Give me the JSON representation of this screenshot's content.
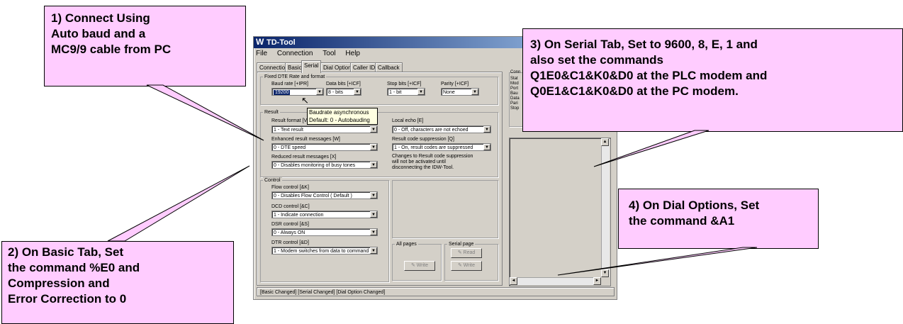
{
  "window": {
    "title": "TD-Tool",
    "menu": [
      "File",
      "Connection",
      "Tool",
      "Help"
    ],
    "tabs": [
      "Connection",
      "Basic",
      "Serial",
      "Dial Options",
      "Caller ID",
      "Callback"
    ],
    "active_tab": "Serial"
  },
  "fixed_dte": {
    "group_title": "Fixed DTE Rate and format",
    "baud_label": "Baud rate [+IPR]",
    "baud_value": "19200",
    "databits_label": "Data bits [+ICF]",
    "databits_value": "8 - bits",
    "stopbits_label": "Stop bits [+ICF]",
    "stopbits_value": "1 - bit",
    "parity_label": "Parity [+ICF]",
    "parity_value": "None"
  },
  "tooltip": {
    "line1": "Baudrate asynchronous",
    "line2": "Default: 0 - Autobauding"
  },
  "result": {
    "group_title": "Result",
    "format_label": "Result format [V",
    "format_value": "1 - Text result",
    "echo_label": "Local echo [E]",
    "echo_value": "0 - Off,  characters are not echoed",
    "enhanced_label": "Enhanced result messages [W]",
    "enhanced_value": "0 - DTE speed",
    "suppression_label": "Result code suppression [Q]",
    "suppression_value": "1 - On, result codes are suppressed",
    "reduced_label": "Reduced result messages [X]",
    "reduced_value": "0 - Disables monitoring of busy tones",
    "note": [
      "Changes to Result code suppression",
      "will not be activated until",
      "disconnecting the IDW-Tool."
    ]
  },
  "control": {
    "group_title": "Control",
    "flow_label": "Flow control [&K]",
    "flow_value": "0 - Disables Flow Control ( Default )",
    "dcd_label": "DCD control [&C]",
    "dcd_value": "1 - Indicate connection",
    "dsr_label": "DSR control [&S]",
    "dsr_value": "0 - Always ON",
    "dtr_label": "DTR control [&D]",
    "dtr_value": "1 - Modem switches from data to command"
  },
  "pages": {
    "all_label": "All pages",
    "serial_label": "Serial page",
    "write_label": "Write",
    "read_label": "Read"
  },
  "right_pane_labels": [
    "Conn",
    "Stat",
    "Mod",
    "Port",
    "Bau",
    "Data",
    "Pari",
    "Stop"
  ],
  "status_text": "[Basic Changed]  [Serial Changed]  [Dial Option Changed]",
  "callouts": {
    "c1": [
      "1) Connect Using",
      "Auto baud and a",
      "MC9/9 cable from PC"
    ],
    "c2": [
      "2) On Basic Tab, Set",
      "the command %E0 and",
      "Compression and",
      "Error Correction to 0"
    ],
    "c3": [
      "3) On Serial Tab, Set to 9600, 8, E, 1 and",
      "also set the commands",
      "Q1E0&C1&K0&D0 at the PLC modem and",
      "Q0E1&C1&K0&D0 at the PC modem."
    ],
    "c4": [
      "4) On Dial Options, Set",
      "the command &A1"
    ]
  },
  "colors": {
    "callout_fill": "#ffccff",
    "titlebar_start": "#0a246a",
    "window_face": "#d4d0c8"
  }
}
